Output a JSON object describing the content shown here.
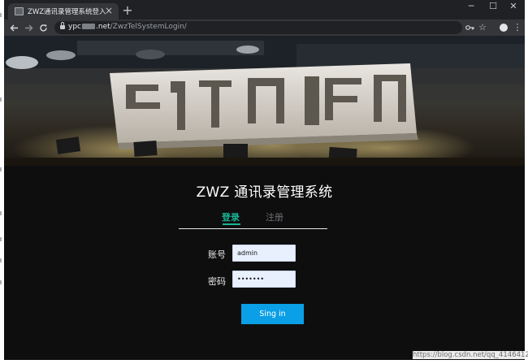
{
  "browser": {
    "tab_title": "ZWZ通讯录管理系统登入",
    "tab_close": "×",
    "new_tab": "+",
    "controls": {
      "minimize": "─",
      "maximize": "☐",
      "close": "✕"
    },
    "url_host_prefix": "ypc",
    "url_host_suffix": ".net",
    "url_path": "/ZwzTelSystemLogin/"
  },
  "page": {
    "hero_image": "stone-letter-sculpture-at-night",
    "title": "ZWZ 通讯录管理系统",
    "tabs": {
      "login": "登录",
      "register": "注册"
    },
    "form": {
      "account_label": "账号",
      "account_value": "admin",
      "password_label": "密码",
      "password_value": "admin12",
      "submit_label": "Sing in"
    }
  },
  "colors": {
    "accent_green": "#1ab394",
    "button_blue": "#0a9fe6",
    "background": "#0e0e0f"
  },
  "watermark": "https://blog.csdn.net/qq_41464123"
}
